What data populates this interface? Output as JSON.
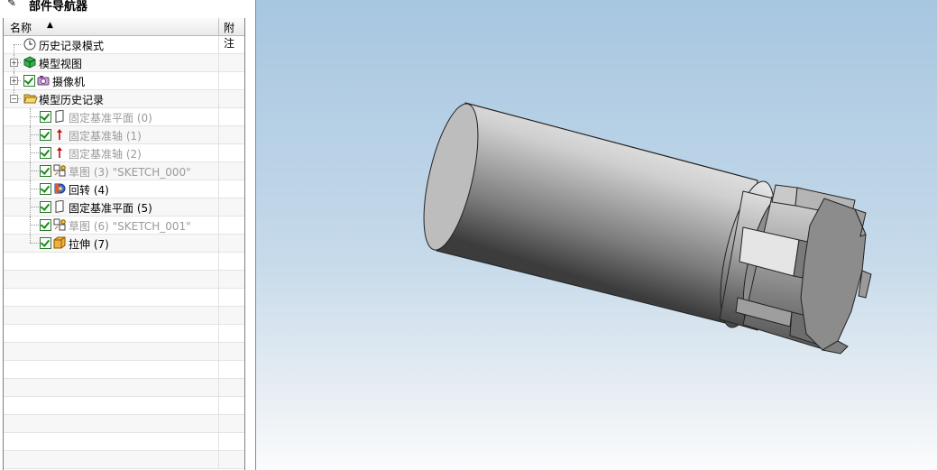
{
  "navigator": {
    "title": "部件导航器",
    "columns": {
      "name": "名称",
      "note": "附注"
    }
  },
  "tree": [
    {
      "label": "历史记录模式",
      "icon": "clock-icon",
      "level": 0,
      "expander": "",
      "checked": false,
      "dim": false
    },
    {
      "label": "模型视图",
      "icon": "model-views-icon",
      "level": 0,
      "expander": "+",
      "checked": false,
      "dim": false
    },
    {
      "label": "摄像机",
      "icon": "camera-icon",
      "level": 0,
      "expander": "+",
      "checked": true,
      "dim": false
    },
    {
      "label": "模型历史记录",
      "icon": "folder-open-icon",
      "level": 0,
      "expander": "-",
      "checked": false,
      "dim": false
    },
    {
      "label": "固定基准平面 (0)",
      "icon": "datum-plane-icon",
      "level": 1,
      "expander": "",
      "checked": true,
      "dim": true
    },
    {
      "label": "固定基准轴 (1)",
      "icon": "datum-axis-icon",
      "level": 1,
      "expander": "",
      "checked": true,
      "dim": true
    },
    {
      "label": "固定基准轴 (2)",
      "icon": "datum-axis-icon",
      "level": 1,
      "expander": "",
      "checked": true,
      "dim": true
    },
    {
      "label": "草图 (3) \"SKETCH_000\"",
      "icon": "sketch-icon",
      "level": 1,
      "expander": "",
      "checked": true,
      "dim": true
    },
    {
      "label": "回转 (4)",
      "icon": "revolve-icon",
      "level": 1,
      "expander": "",
      "checked": true,
      "dim": false
    },
    {
      "label": "固定基准平面 (5)",
      "icon": "datum-plane-icon",
      "level": 1,
      "expander": "",
      "checked": true,
      "dim": false
    },
    {
      "label": "草图 (6) \"SKETCH_001\"",
      "icon": "sketch-icon",
      "level": 1,
      "expander": "",
      "checked": true,
      "dim": true
    },
    {
      "label": "拉伸 (7)",
      "icon": "extrude-icon",
      "level": 1,
      "expander": "",
      "checked": true,
      "dim": false
    }
  ],
  "colors": {
    "check_green": "#1a8a1a",
    "dim_text": "#9a9a9a",
    "viewport_top": "#a7c6e0",
    "viewport_bottom": "#fbfcfd"
  }
}
